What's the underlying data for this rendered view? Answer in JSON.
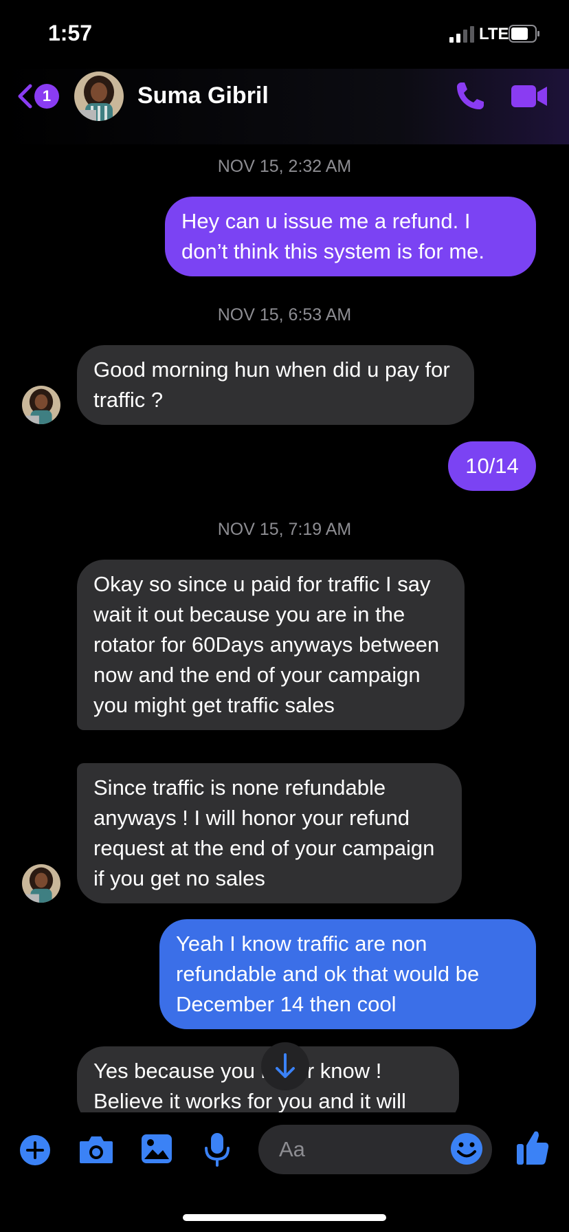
{
  "status": {
    "time": "1:57",
    "network": "LTE",
    "battery_level": 0.72
  },
  "header": {
    "back_badge": "1",
    "contact_name": "Suma Gibril",
    "accent": "#8a3cf2"
  },
  "conversation": {
    "timestamps": [
      "NOV 15, 2:32 AM",
      "NOV 15, 6:53 AM",
      "NOV 15, 7:19 AM"
    ],
    "messages": [
      {
        "from": "me",
        "text": "Hey can u issue me a refund. I don’t think this system is for me."
      },
      {
        "from": "them",
        "text": "Good morning hun when did u pay for traffic ?"
      },
      {
        "from": "me",
        "text": "10/14"
      },
      {
        "from": "them",
        "text": "Okay so since u paid for traffic I say wait it out because you are in the rotator for 60Days anyways between now and the end of your campaign you might get traffic sales"
      },
      {
        "from": "them",
        "text": "Since traffic is none refundable anyways ! I will honor your refund request at the end of your campaign if you get no sales"
      },
      {
        "from": "me",
        "text": "Yeah I know traffic are non refundable and ok that would be December 14 then cool"
      },
      {
        "from": "them",
        "text": "Yes because you never know ! Believe it works for you and it will"
      }
    ]
  },
  "composer": {
    "placeholder": "Aa",
    "icons": [
      "plus-icon",
      "camera-icon",
      "image-icon",
      "mic-icon",
      "emoji-icon",
      "thumbs-up-icon"
    ]
  },
  "colors": {
    "outgoing_purple": "#7b43f3",
    "outgoing_blue": "#3b6fe8",
    "incoming": "#303032",
    "icon_blue": "#3b82f6"
  }
}
